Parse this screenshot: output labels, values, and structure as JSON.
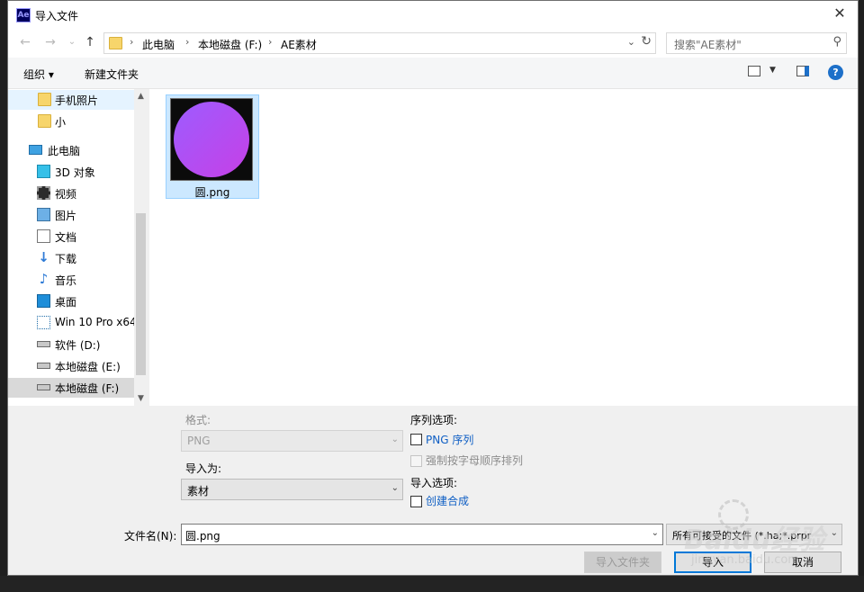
{
  "window": {
    "app_icon": "Ae",
    "title": "导入文件",
    "close_glyph": "✕"
  },
  "nav": {
    "back_glyph": "←",
    "forward_glyph": "→",
    "recent_glyph": "⌄",
    "up_glyph": "↑",
    "breadcrumb": [
      "此电脑",
      "本地磁盘 (F:)",
      "AE素材"
    ],
    "search_placeholder": "搜索\"AE素材\""
  },
  "toolbar": {
    "organize": "组织 ▾",
    "new_folder": "新建文件夹",
    "help": "?"
  },
  "sidebar": {
    "items": [
      {
        "label": "手机照片",
        "icon": "folder-icon"
      },
      {
        "label": "小",
        "icon": "folder-icon"
      },
      {
        "label": "此电脑",
        "icon": "computer-icon"
      },
      {
        "label": "3D 对象",
        "icon": "3d-objects-icon"
      },
      {
        "label": "视频",
        "icon": "video-icon"
      },
      {
        "label": "图片",
        "icon": "pictures-icon"
      },
      {
        "label": "文档",
        "icon": "documents-icon"
      },
      {
        "label": "下载",
        "icon": "download-icon"
      },
      {
        "label": "音乐",
        "icon": "music-icon"
      },
      {
        "label": "桌面",
        "icon": "desktop-icon"
      },
      {
        "label": "Win 10 Pro x64",
        "icon": "network-drive-icon"
      },
      {
        "label": "软件 (D:)",
        "icon": "drive-icon"
      },
      {
        "label": "本地磁盘 (E:)",
        "icon": "drive-icon"
      },
      {
        "label": "本地磁盘 (F:)",
        "icon": "drive-icon"
      }
    ]
  },
  "files": [
    {
      "name": "圆.png"
    }
  ],
  "options": {
    "format_label": "格式:",
    "format_value": "PNG",
    "import_as_label": "导入为:",
    "import_as_value": "素材",
    "sequence_label": "序列选项:",
    "png_sequence": "PNG 序列",
    "force_alpha": "强制按字母顺序排列",
    "import_options_label": "导入选项:",
    "create_comp": "创建合成"
  },
  "footer": {
    "filename_label": "文件名(N):",
    "filename_value": "圆.png",
    "filetype_value": "所有可接受的文件 (*.ha;*.prpr",
    "import_folder": "导入文件夹",
    "import": "导入",
    "cancel": "取消"
  },
  "watermark": {
    "text": "Baidu经验",
    "sub": "jingyan.baidu.com"
  }
}
